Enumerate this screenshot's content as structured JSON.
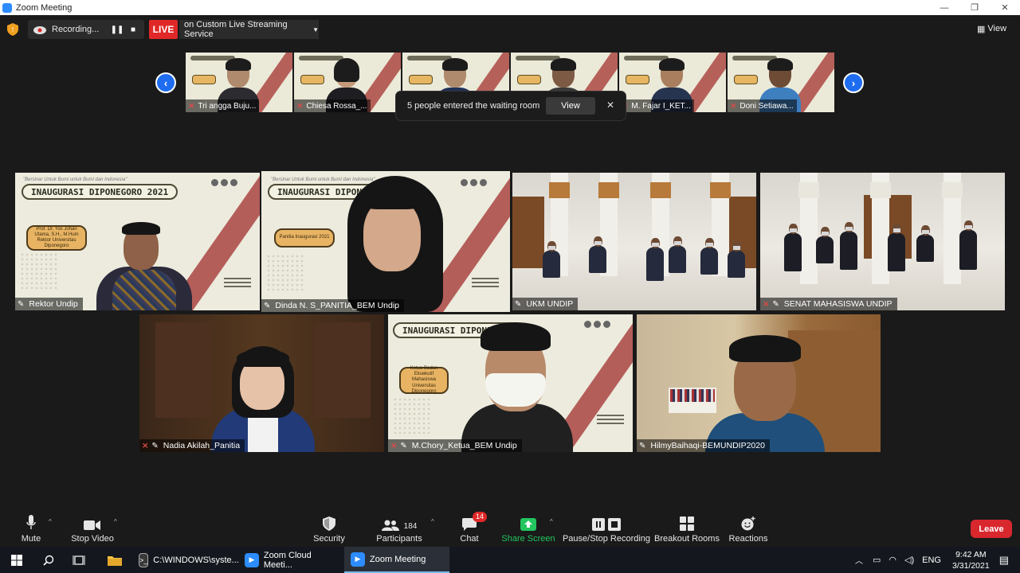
{
  "window": {
    "title": "Zoom Meeting",
    "controls": [
      "—",
      "❐",
      "✕"
    ]
  },
  "topbar": {
    "recording_label": "Recording...",
    "live_badge": "LIVE",
    "live_service": "on Custom Live Streaming Service",
    "view_label": "View"
  },
  "strip": {
    "thumbnails": [
      {
        "name": "Tri angga Buju..."
      },
      {
        "name": "Chiesa Rossa_..."
      },
      {
        "name": ""
      },
      {
        "name": ""
      },
      {
        "name": "M. Fajar I_KET..."
      },
      {
        "name": "Doni Setiawa..."
      }
    ],
    "toast_text": "5 people entered the waiting room",
    "toast_view": "View",
    "toast_close": "✕"
  },
  "tiles": {
    "rektor": {
      "name": "Rektor Undip",
      "banner": "INAUGURASI DIPONEGORO 2021",
      "tagline": "\"Bersinar Untuk Bumi untuk Bumi dan Indonesia\"",
      "card": "Prof. Dr. Yos Johan Utama, S.H., M.Hum Rektor Universitas Diponegoro"
    },
    "dinda": {
      "name": "Dinda N. S_PANITIA_BEM Undip",
      "banner": "INAUGURASI DIPONEGO",
      "tagline": "\"Bersinar Untuk Bumi untuk Bumi dan Indonesia\"",
      "card": "Panitia Inaugurasi 2021"
    },
    "ukm": {
      "name": "UKM UNDIP"
    },
    "senat": {
      "name": "SENAT MAHASISWA UNDIP"
    },
    "nadia": {
      "name": "Nadia Akilah_Panitia"
    },
    "chory": {
      "name": "M.Chory_Ketua_BEM Undip",
      "banner": "INAUGURASI DIPONEGORO",
      "card": "Ketua Badan Eksekutif Mahasiswa Universitas Diponegoro"
    },
    "hilmy": {
      "name": "HilmyBaihaqi-BEMUNDIP2020"
    }
  },
  "toolbar": {
    "mute": "Mute",
    "stop_video": "Stop Video",
    "security": "Security",
    "participants": "Participants",
    "participants_count": "184",
    "chat": "Chat",
    "chat_badge": "14",
    "share_screen": "Share Screen",
    "recording": "Pause/Stop Recording",
    "breakout": "Breakout Rooms",
    "reactions": "Reactions",
    "leave": "Leave"
  },
  "taskbar": {
    "apps": [
      {
        "label": "C:\\WINDOWS\\syste..."
      },
      {
        "label": "Zoom Cloud Meeti..."
      },
      {
        "label": "Zoom Meeting"
      }
    ],
    "language": "ENG",
    "time": "9:42 AM",
    "date": "3/31/2021"
  },
  "colors": {
    "live": "#e02828",
    "share_green": "#22c55e",
    "leave": "#d9272e",
    "active_speaker": "#d4e157",
    "accent_blue": "#2d8cff"
  }
}
